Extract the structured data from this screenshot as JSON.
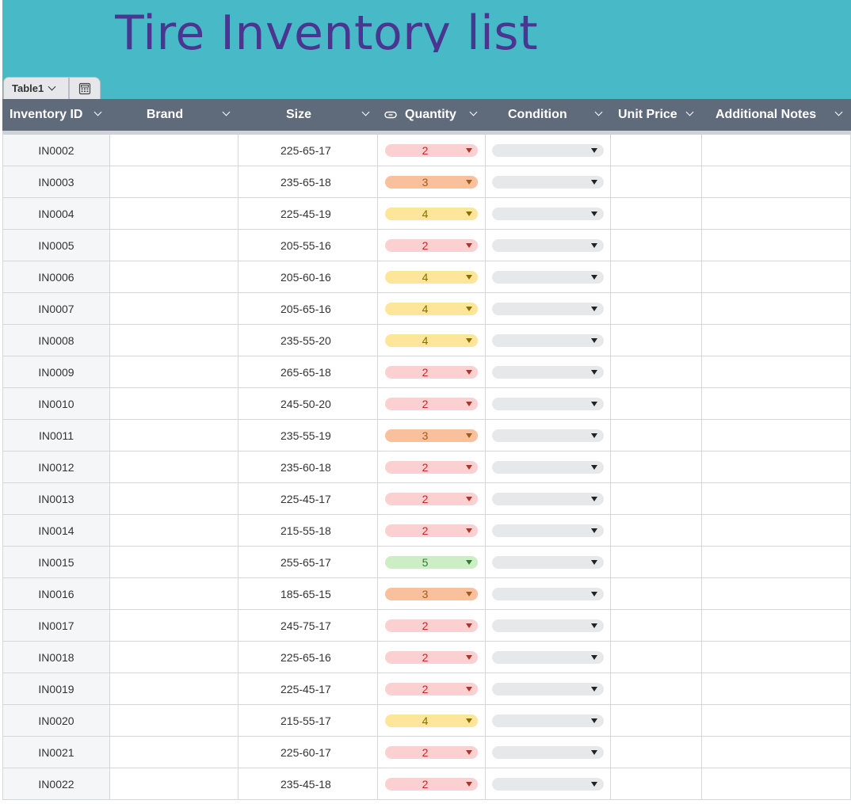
{
  "title": "Tire Inventory list",
  "table_tab": {
    "label": "Table1"
  },
  "columns": [
    {
      "label": "Inventory ID"
    },
    {
      "label": "Brand"
    },
    {
      "label": "Size"
    },
    {
      "label": "Quantity",
      "icon": "link-icon"
    },
    {
      "label": "Condition"
    },
    {
      "label": "Unit Price"
    },
    {
      "label": "Additional Notes"
    }
  ],
  "colors": {
    "banner": "#48b9c7",
    "title": "#4a3690",
    "header": "#5f6b7a",
    "qty_2": "#fbd0d0",
    "qty_3": "#f9c09e",
    "qty_4": "#fde59a",
    "qty_5": "#cdedc4"
  },
  "rows": [
    {
      "id": "IN0002",
      "size": "225-65-17",
      "qty": "2"
    },
    {
      "id": "IN0003",
      "size": "235-65-18",
      "qty": "3"
    },
    {
      "id": "IN0004",
      "size": "225-45-19",
      "qty": "4"
    },
    {
      "id": "IN0005",
      "size": "205-55-16",
      "qty": "2"
    },
    {
      "id": "IN0006",
      "size": "205-60-16",
      "qty": "4"
    },
    {
      "id": "IN0007",
      "size": "205-65-16",
      "qty": "4"
    },
    {
      "id": "IN0008",
      "size": "235-55-20",
      "qty": "4"
    },
    {
      "id": "IN0009",
      "size": "265-65-18",
      "qty": "2"
    },
    {
      "id": "IN0010",
      "size": "245-50-20",
      "qty": "2"
    },
    {
      "id": "IN0011",
      "size": "235-55-19",
      "qty": "3"
    },
    {
      "id": "IN0012",
      "size": "235-60-18",
      "qty": "2"
    },
    {
      "id": "IN0013",
      "size": "225-45-17",
      "qty": "2"
    },
    {
      "id": "IN0014",
      "size": "215-55-18",
      "qty": "2"
    },
    {
      "id": "IN0015",
      "size": "255-65-17",
      "qty": "5"
    },
    {
      "id": "IN0016",
      "size": "185-65-15",
      "qty": "3"
    },
    {
      "id": "IN0017",
      "size": "245-75-17",
      "qty": "2"
    },
    {
      "id": "IN0018",
      "size": "225-65-16",
      "qty": "2"
    },
    {
      "id": "IN0019",
      "size": "225-45-17",
      "qty": "2"
    },
    {
      "id": "IN0020",
      "size": "215-55-17",
      "qty": "4"
    },
    {
      "id": "IN0021",
      "size": "225-60-17",
      "qty": "2"
    },
    {
      "id": "IN0022",
      "size": "235-45-18",
      "qty": "2"
    }
  ]
}
